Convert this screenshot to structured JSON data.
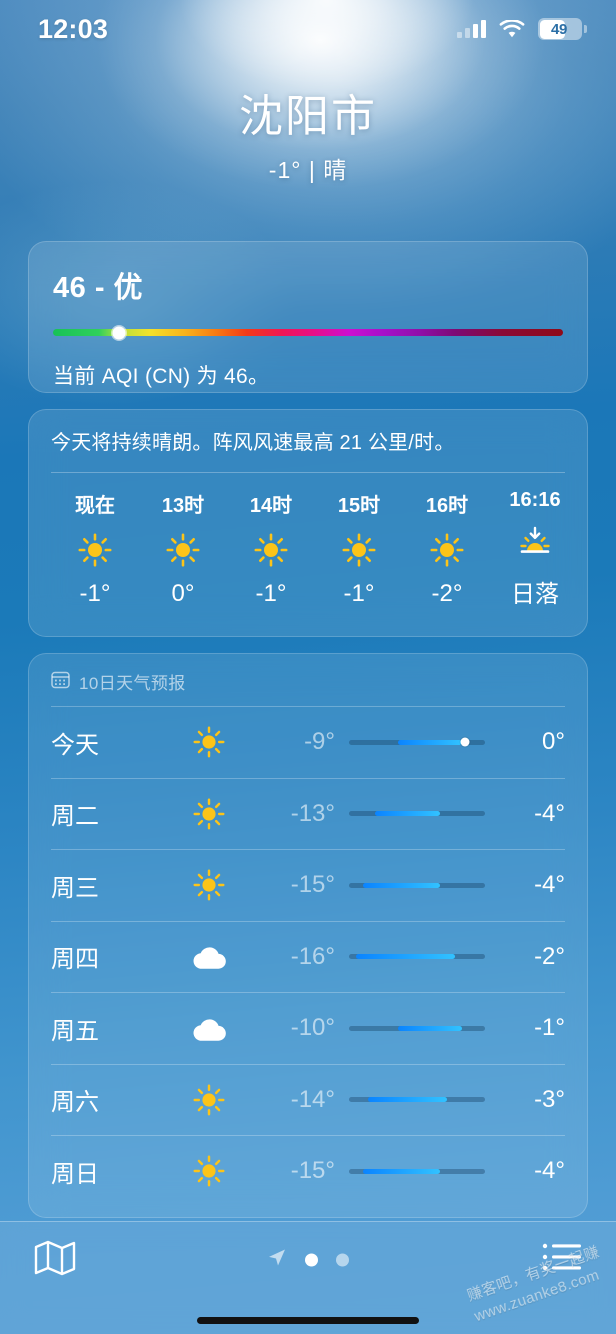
{
  "status_bar": {
    "time": "12:03",
    "battery_level": "49",
    "cellular_icon": "cellular-bars-icon",
    "wifi_icon": "wifi-icon"
  },
  "header": {
    "city": "沈阳市",
    "condition_line": "-1° | 晴",
    "current_temp": "-1°",
    "condition": "晴"
  },
  "aqi_card": {
    "value_label": "46 - 优",
    "value": 46,
    "category": "优",
    "description": "当前 AQI (CN) 为 46。",
    "marker_position_pct": 13,
    "scale_colors": [
      "#18c257",
      "#f3e12b",
      "#f77a12",
      "#f23a18",
      "#e60f87",
      "#a411c9",
      "#8f0a18"
    ]
  },
  "hourly_card": {
    "summary": "今天将持续晴朗。阵风风速最高 21 公里/时。",
    "hours": [
      {
        "label": "现在",
        "icon": "sun-icon",
        "temp": "-1°"
      },
      {
        "label": "13时",
        "icon": "sun-icon",
        "temp": "0°"
      },
      {
        "label": "14时",
        "icon": "sun-icon",
        "temp": "-1°"
      },
      {
        "label": "15时",
        "icon": "sun-icon",
        "temp": "-1°"
      },
      {
        "label": "16时",
        "icon": "sun-icon",
        "temp": "-2°"
      },
      {
        "label": "16:16",
        "icon": "sunset-icon",
        "temp": "日落"
      }
    ]
  },
  "daily_card": {
    "title": "10日天气预报",
    "title_icon": "calendar-icon",
    "days": [
      {
        "name": "今天",
        "icon": "sun-icon",
        "low": "-9°",
        "high": "0°",
        "bar_start_pct": 36,
        "bar_end_pct": 83,
        "now_pct": 85
      },
      {
        "name": "周二",
        "icon": "sun-icon",
        "low": "-13°",
        "high": "-4°",
        "bar_start_pct": 19,
        "bar_end_pct": 67,
        "now_pct": null
      },
      {
        "name": "周三",
        "icon": "sun-icon",
        "low": "-15°",
        "high": "-4°",
        "bar_start_pct": 10,
        "bar_end_pct": 67,
        "now_pct": null
      },
      {
        "name": "周四",
        "icon": "cloud-icon",
        "low": "-16°",
        "high": "-2°",
        "bar_start_pct": 5,
        "bar_end_pct": 78,
        "now_pct": null
      },
      {
        "name": "周五",
        "icon": "cloud-icon",
        "low": "-10°",
        "high": "-1°",
        "bar_start_pct": 36,
        "bar_end_pct": 83,
        "now_pct": null
      },
      {
        "name": "周六",
        "icon": "sun-icon",
        "low": "-14°",
        "high": "-3°",
        "bar_start_pct": 14,
        "bar_end_pct": 72,
        "now_pct": null
      },
      {
        "name": "周日",
        "icon": "sun-icon",
        "low": "-15°",
        "high": "-4°",
        "bar_start_pct": 10,
        "bar_end_pct": 67,
        "now_pct": null
      }
    ]
  },
  "tab_bar": {
    "map_icon": "map-icon",
    "list_icon": "list-icon",
    "location_icon": "location-arrow-icon",
    "page_count": 2,
    "active_page": 1
  },
  "watermark": {
    "line1": "赚客吧，有奖一起赚",
    "line2": "www.zuanke8.com"
  }
}
